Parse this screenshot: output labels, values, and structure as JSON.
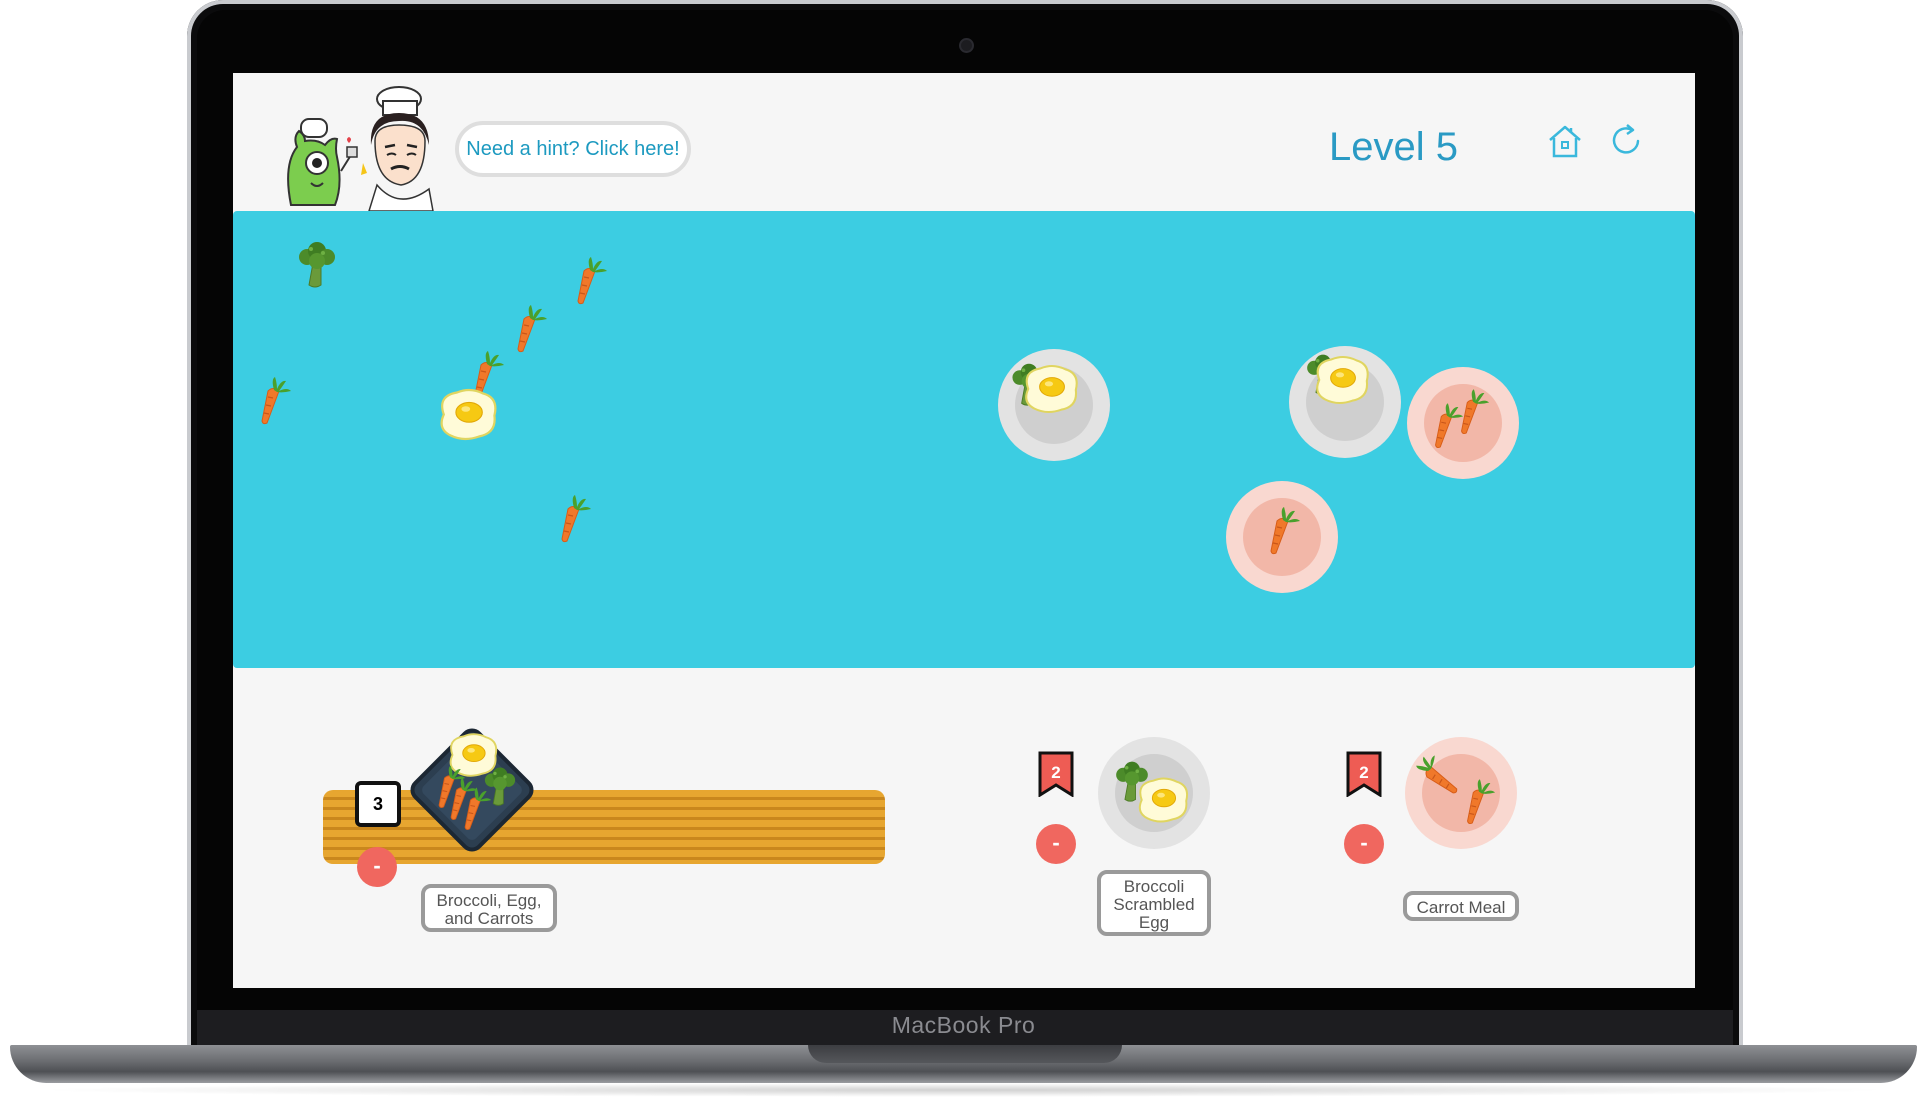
{
  "device": {
    "brand": "MacBook Pro"
  },
  "header": {
    "hint_label": "Need a hint? Click here!",
    "level_label": "Level 5",
    "home_icon": "home-icon",
    "refresh_icon": "refresh-icon"
  },
  "meals": [
    {
      "name": "Broccoli, Egg, and Carrots",
      "count": "3",
      "ingredients": [
        "egg",
        "broccoli",
        "carrot",
        "carrot",
        "carrot"
      ]
    },
    {
      "name": "Broccoli Scrambled Egg",
      "count": "2",
      "ingredients": [
        "broccoli",
        "egg"
      ]
    },
    {
      "name": "Carrot Meal",
      "count": "2",
      "ingredients": [
        "carrot",
        "carrot"
      ]
    }
  ],
  "minus_label": "-",
  "colors": {
    "field": "#3ccde2",
    "accent": "#2a9ac4",
    "minus": "#f0675f",
    "flag": "#ee5c54"
  }
}
